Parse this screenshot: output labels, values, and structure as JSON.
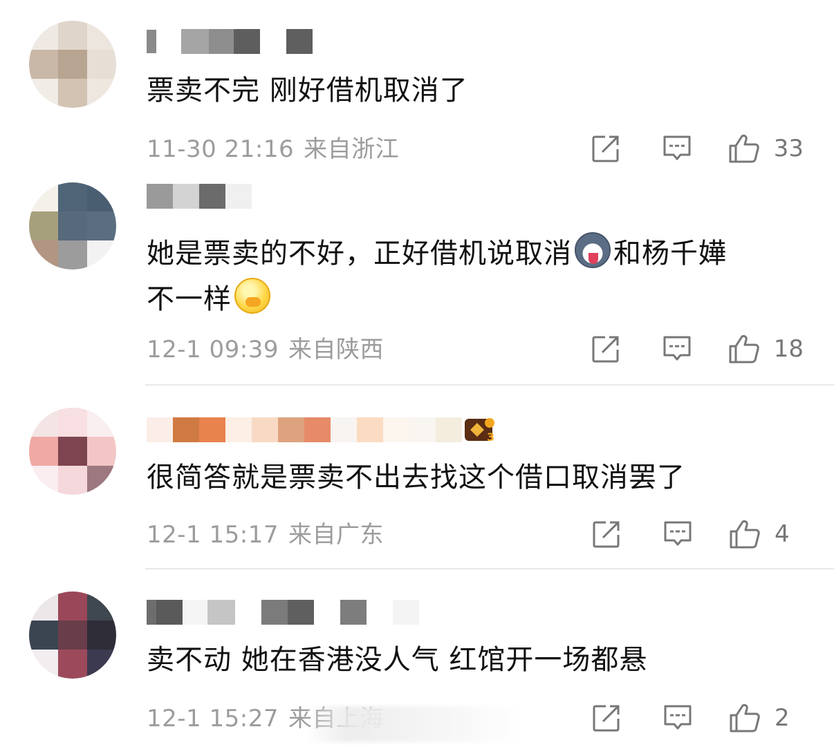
{
  "comments": [
    {
      "text": "票卖不完 刚好借机取消了",
      "time": "11-30 21:16",
      "location": "来自浙江",
      "likes": "33",
      "avatar_icon": "blurred-avatar",
      "emojis": []
    },
    {
      "text_part1": "她是票卖的不好，正好借机说取消",
      "text_part2": "和杨千嬅",
      "text_part3": "不一样",
      "time": "12-1 09:39",
      "location": "来自陕西",
      "likes": "18",
      "avatar_icon": "blurred-avatar",
      "emojis": [
        "husky-emoji",
        "shy-emoji"
      ]
    },
    {
      "text": "很简答就是票卖不出去找这个借口取消罢了",
      "time": "12-1 15:17",
      "location": "来自广东",
      "likes": "4",
      "avatar_icon": "blurred-avatar",
      "badge_icon": "fan-level-badge-icon",
      "emojis": []
    },
    {
      "text": "卖不动 她在香港没人气 红馆开一场都悬",
      "time": "12-1 15:27",
      "location": "来自上海",
      "likes": "2",
      "avatar_icon": "blurred-avatar",
      "emojis": []
    }
  ],
  "icons": {
    "share": "share-icon",
    "reply": "comment-icon",
    "like": "thumbs-up-icon"
  },
  "colors": {
    "text": "#111111",
    "meta": "#9c9c9c",
    "icon": "#777777",
    "divider": "#e8e8e8"
  }
}
